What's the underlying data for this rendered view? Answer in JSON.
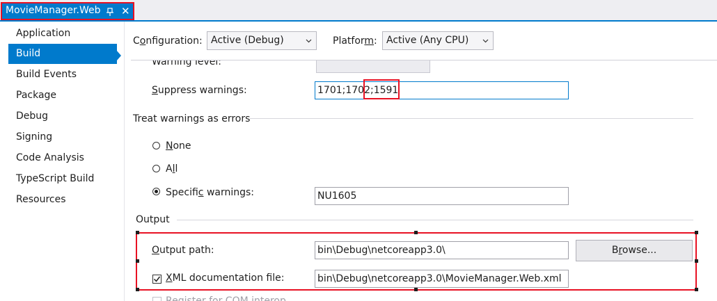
{
  "tab": {
    "title": "MovieManager.Web"
  },
  "nav": {
    "items": [
      {
        "label": "Application",
        "selected": false
      },
      {
        "label": "Build",
        "selected": true
      },
      {
        "label": "Build Events",
        "selected": false
      },
      {
        "label": "Package",
        "selected": false
      },
      {
        "label": "Debug",
        "selected": false
      },
      {
        "label": "Signing",
        "selected": false
      },
      {
        "label": "Code Analysis",
        "selected": false
      },
      {
        "label": "TypeScript Build",
        "selected": false
      },
      {
        "label": "Resources",
        "selected": false
      }
    ]
  },
  "header": {
    "configuration_label_pre": "C",
    "configuration_label_u": "o",
    "configuration_label_post": "nfiguration:",
    "configuration_value": "Active (Debug)",
    "platform_label_pre": "Platfor",
    "platform_label_u": "m",
    "platform_label_post": ":",
    "platform_value": "Active (Any CPU)"
  },
  "build": {
    "warning_level_label": "Warning level:",
    "suppress_label_u": "S",
    "suppress_label_post": "uppress warnings:",
    "suppress_value_pre": "1701;1702;",
    "suppress_value_hl": "1591",
    "treat_warnings_heading": "Treat warnings as errors",
    "radio_none_u": "N",
    "radio_none_post": "one",
    "radio_all_pre": "A",
    "radio_all_u": "l",
    "radio_all_post": "l",
    "radio_specific_pre": "Specifi",
    "radio_specific_u": "c",
    "radio_specific_post": " warnings:",
    "specific_value": "NU1605",
    "selected_radio": "specific"
  },
  "output": {
    "heading": "Output",
    "output_path_label_u": "O",
    "output_path_label_post": "utput path:",
    "output_path_value": "bin\\Debug\\netcoreapp3.0\\",
    "browse_pre": "B",
    "browse_u": "r",
    "browse_post": "owse...",
    "xml_label_u": "X",
    "xml_label_post": "ML documentation file:",
    "xml_value": "bin\\Debug\\netcoreapp3.0\\MovieManager.Web.xml",
    "xml_checked": true,
    "register_com_label": "Register for COM interop"
  },
  "colors": {
    "accent": "#007acc",
    "highlight": "#e81123"
  }
}
